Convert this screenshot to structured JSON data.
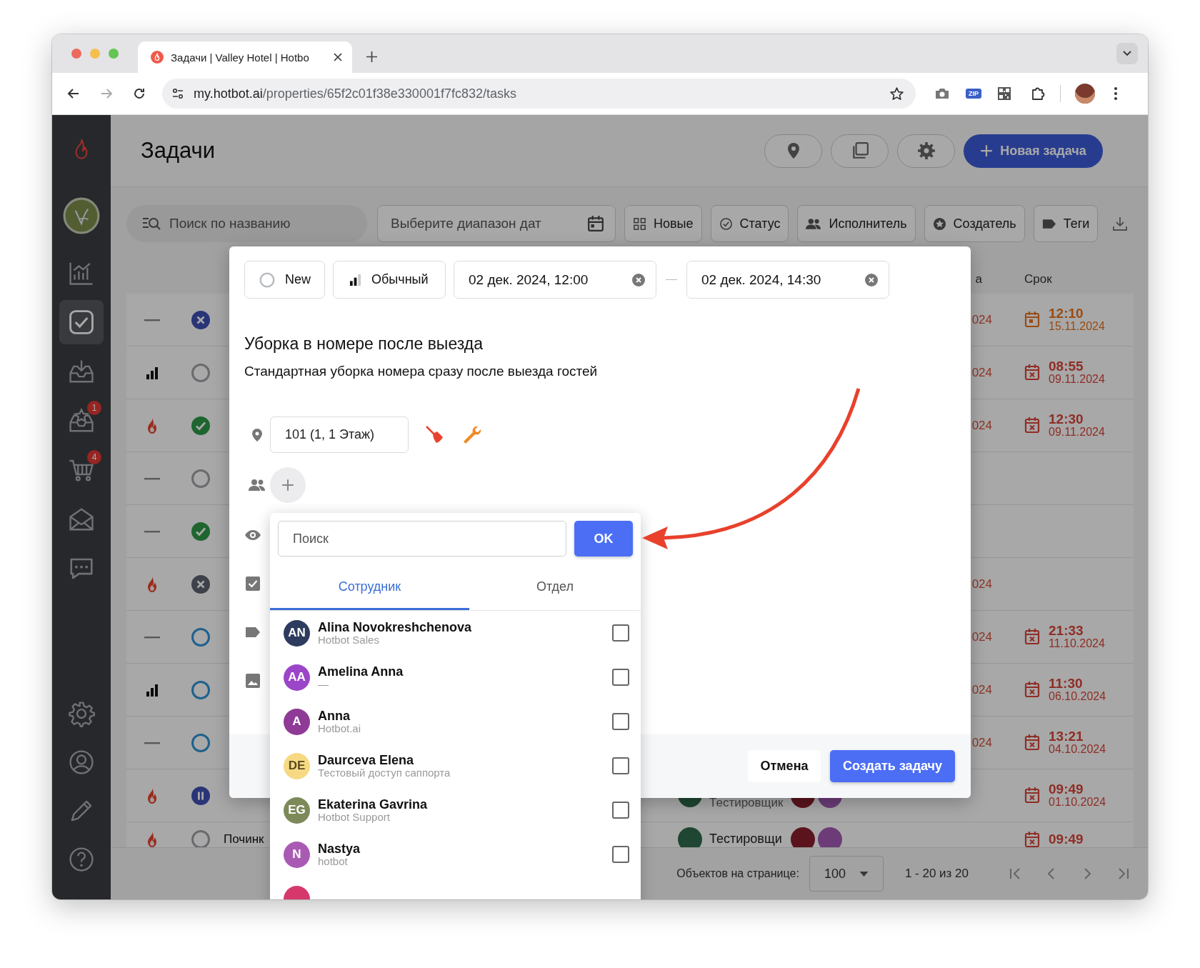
{
  "browser": {
    "tab_title": "Задачи | Valley Hotel | Hotbo",
    "url_host": "my.hotbot.ai",
    "url_path": "/properties/65f2c01f38e330001f7fc832/tasks",
    "extension_badge": "ZIP"
  },
  "sidebar": {
    "items": [
      {
        "selected": false
      },
      {
        "selected": true
      },
      {
        "selected": false
      },
      {
        "selected": false,
        "badge": "1"
      },
      {
        "selected": false,
        "badge": "4"
      },
      {
        "selected": false
      },
      {
        "selected": false
      }
    ]
  },
  "header": {
    "title": "Задачи",
    "new_task_button": "Новая задача"
  },
  "filters": {
    "search_placeholder": "Поиск по названию",
    "date_placeholder": "Выберите диапазон дат",
    "chips": [
      {
        "label": "Новые"
      },
      {
        "label": "Статус"
      },
      {
        "label": "Исполнитель"
      },
      {
        "label": "Создатель"
      },
      {
        "label": "Теги"
      }
    ]
  },
  "table": {
    "columns": [
      {
        "label": "а"
      },
      {
        "label": "Срок"
      }
    ],
    "rows": [
      {
        "priority": {
          "kind": "none"
        },
        "status": {
          "kind": "cancelled"
        },
        "column_a": "024",
        "deadline_time": "12:10",
        "deadline_date": "15.11.2024",
        "overdue": false
      },
      {
        "priority": {
          "kind": "normal"
        },
        "status": {
          "kind": "new"
        },
        "column_a": "024",
        "deadline_time": "08:55",
        "deadline_date": "09.11.2024",
        "overdue": true
      },
      {
        "priority": {
          "kind": "urgent"
        },
        "status": {
          "kind": "done"
        },
        "column_a": "024",
        "deadline_time": "12:30",
        "deadline_date": "09.11.2024",
        "overdue": true
      },
      {
        "priority": {
          "kind": "none"
        },
        "status": {
          "kind": "new"
        }
      },
      {
        "priority": {
          "kind": "none"
        },
        "status": {
          "kind": "done"
        }
      },
      {
        "priority": {
          "kind": "urgent"
        },
        "status": {
          "kind": "rejected"
        },
        "column_a": "024"
      },
      {
        "priority": {
          "kind": "none"
        },
        "status": {
          "kind": "accepted"
        },
        "column_a": "024",
        "deadline_time": "21:33",
        "deadline_date": "11.10.2024",
        "overdue": true
      },
      {
        "priority": {
          "kind": "normal"
        },
        "status": {
          "kind": "accepted"
        },
        "column_a": "024",
        "deadline_time": "11:30",
        "deadline_date": "06.10.2024",
        "overdue": true
      },
      {
        "priority": {
          "kind": "none"
        },
        "status": {
          "kind": "accepted"
        },
        "column_a": "024",
        "deadline_time": "13:21",
        "deadline_date": "04.10.2024",
        "overdue": true
      },
      {
        "priority": {
          "kind": "urgent"
        },
        "status": {
          "kind": "paused"
        },
        "assignee_role": "Тестировщик",
        "deadline_time": "09:49",
        "deadline_date": "01.10.2024",
        "overdue": true
      },
      {
        "priority": {
          "kind": "urgent"
        },
        "status": {
          "kind": "new"
        },
        "title": "Починк",
        "assignee": "Тестировщи",
        "deadline_time": "09:49",
        "overdue": true
      }
    ]
  },
  "pagination": {
    "per_page_label": "Объектов на странице:",
    "per_page": "100",
    "range": "1 - 20 из 20"
  },
  "modal": {
    "status_chip": "New",
    "priority_chip": "Обычный",
    "start": "02 дек. 2024, 12:00",
    "end": "02 дек. 2024, 14:30",
    "title": "Уборка в номере после выезда",
    "description": "Стандартная уборка номера сразу после выезда гостей",
    "location": "101 (1, 1 Этаж)",
    "cancel_button": "Отмена",
    "submit_button": "Создать задачу"
  },
  "picker": {
    "search_placeholder": "Поиск",
    "ok_button": "OK",
    "tabs": [
      {
        "label": "Сотрудник",
        "selected": true
      },
      {
        "label": "Отдел",
        "selected": false
      }
    ],
    "people": [
      {
        "initials": "AN",
        "name": "Alina Novokreshchenova",
        "org": "Hotbot Sales",
        "color": "#2d3b5e",
        "checked": false
      },
      {
        "initials": "AA",
        "name": "Amelina Anna",
        "org": "—",
        "color": "#9b45c9",
        "checked": false
      },
      {
        "initials": "A",
        "name": "Anna",
        "org": "Hotbot.ai",
        "color": "#8e3a96",
        "checked": false
      },
      {
        "initials": "DE",
        "name": "Daurceva Elena",
        "org": "Тестовый доступ саппорта",
        "color": "#f6d982",
        "checked": false
      },
      {
        "initials": "EG",
        "name": "Ekaterina Gavrina",
        "org": "Hotbot Support",
        "color": "#7c8a5a",
        "checked": false
      },
      {
        "initials": "N",
        "name": "Nastya",
        "org": "hotbot",
        "color": "#a95bb4",
        "checked": false
      },
      {
        "color": "#d6386c"
      }
    ]
  }
}
